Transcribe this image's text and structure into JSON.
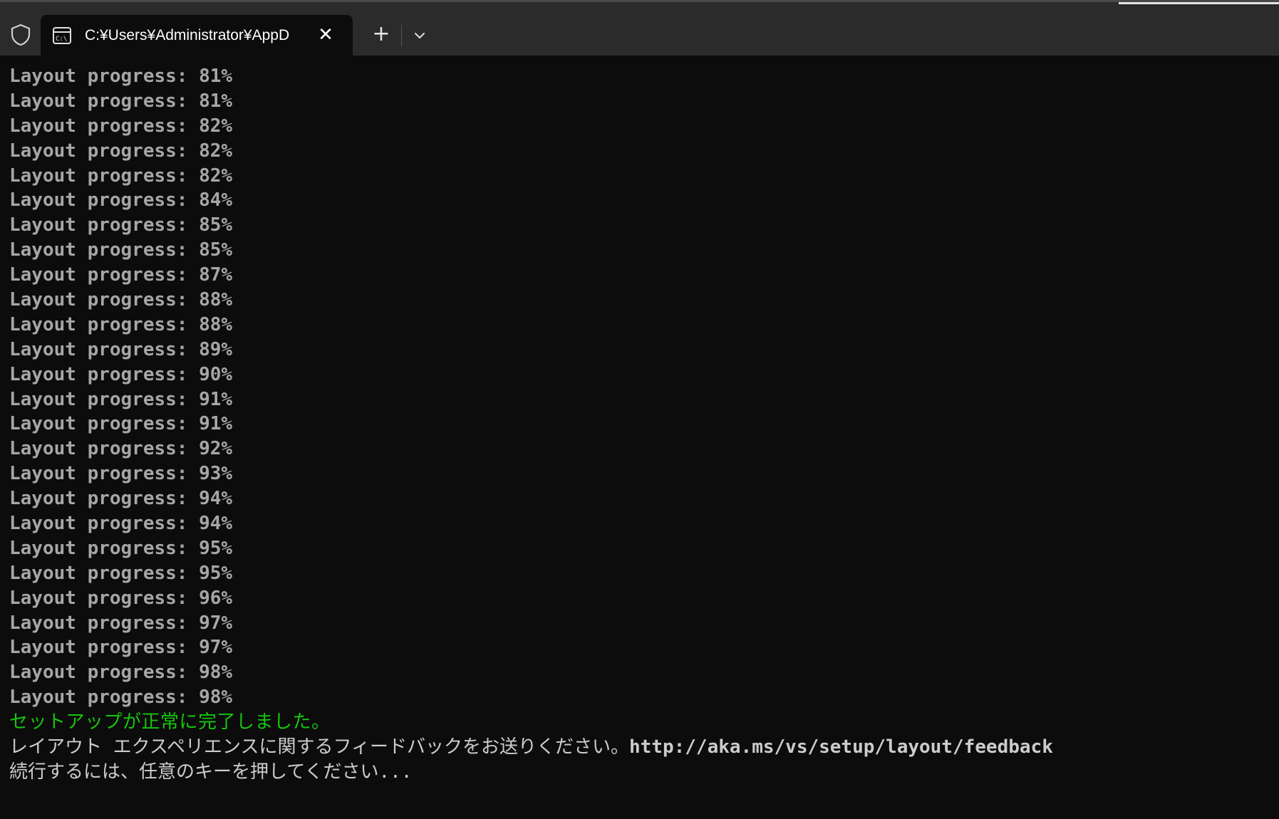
{
  "window": {
    "tab_title": "C:¥Users¥Administrator¥AppD",
    "tab_icon": "console-icon",
    "close_icon": "close-icon",
    "new_tab_label": "+",
    "dropdown_icon": "chevron-down-icon",
    "shield_icon": "shield-icon"
  },
  "console": {
    "progress_lines": [
      "Layout progress: 81%",
      "Layout progress: 81%",
      "Layout progress: 82%",
      "Layout progress: 82%",
      "Layout progress: 82%",
      "Layout progress: 84%",
      "Layout progress: 85%",
      "Layout progress: 85%",
      "Layout progress: 87%",
      "Layout progress: 88%",
      "Layout progress: 88%",
      "Layout progress: 89%",
      "Layout progress: 90%",
      "Layout progress: 91%",
      "Layout progress: 91%",
      "Layout progress: 92%",
      "Layout progress: 93%",
      "Layout progress: 94%",
      "Layout progress: 94%",
      "Layout progress: 95%",
      "Layout progress: 95%",
      "Layout progress: 96%",
      "Layout progress: 97%",
      "Layout progress: 97%",
      "Layout progress: 98%",
      "Layout progress: 98%"
    ],
    "success_message": "セットアップが正常に完了しました。",
    "feedback_text": "レイアウト エクスペリエンスに関するフィードバックをお送りください。",
    "feedback_url": "http://aka.ms/vs/setup/layout/feedback",
    "continue_prompt": "続行するには、任意のキーを押してください..."
  },
  "colors": {
    "background": "#0c0c0c",
    "titlebar": "#2b2b2b",
    "text": "#a6a6a6",
    "success": "#16c60c"
  }
}
